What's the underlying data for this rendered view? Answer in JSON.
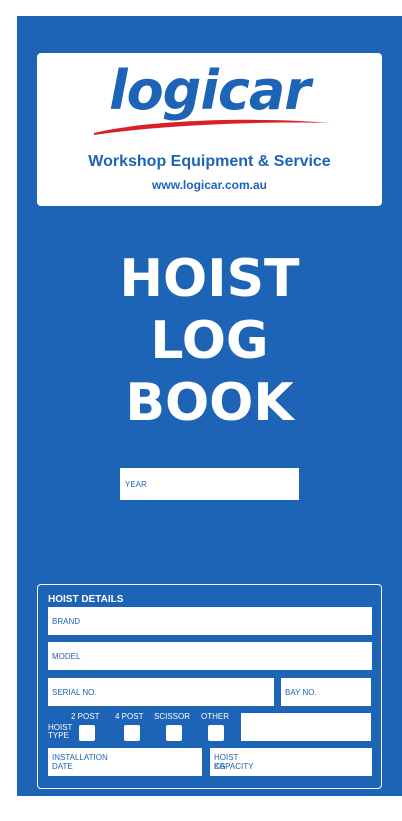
{
  "logo": {
    "brand": "logicar",
    "tagline": "Workshop Equipment & Service",
    "url": "www.logicar.com.au",
    "swoosh_color": "#d92027"
  },
  "title_lines": [
    "HOIST",
    "LOG",
    "BOOK"
  ],
  "year_label": "YEAR",
  "hoist_details": {
    "heading": "HOIST DETAILS",
    "brand_label": "BRAND",
    "model_label": "MODEL",
    "serial_label": "SERIAL NO.",
    "bay_label": "BAY NO.",
    "hoist_type_label_1": "HOIST",
    "hoist_type_label_2": "TYPE",
    "options": [
      "2 POST",
      "4 POST",
      "SCISSOR",
      "OTHER"
    ],
    "installation_label_1": "INSTALLATION",
    "installation_label_2": "DATE",
    "capacity_label_1": "HOIST",
    "capacity_label_2": "CAPACITY",
    "capacity_unit": "KG"
  },
  "colors": {
    "cover_blue": "#1d63b6",
    "white": "#ffffff",
    "logo_red": "#d92027"
  }
}
